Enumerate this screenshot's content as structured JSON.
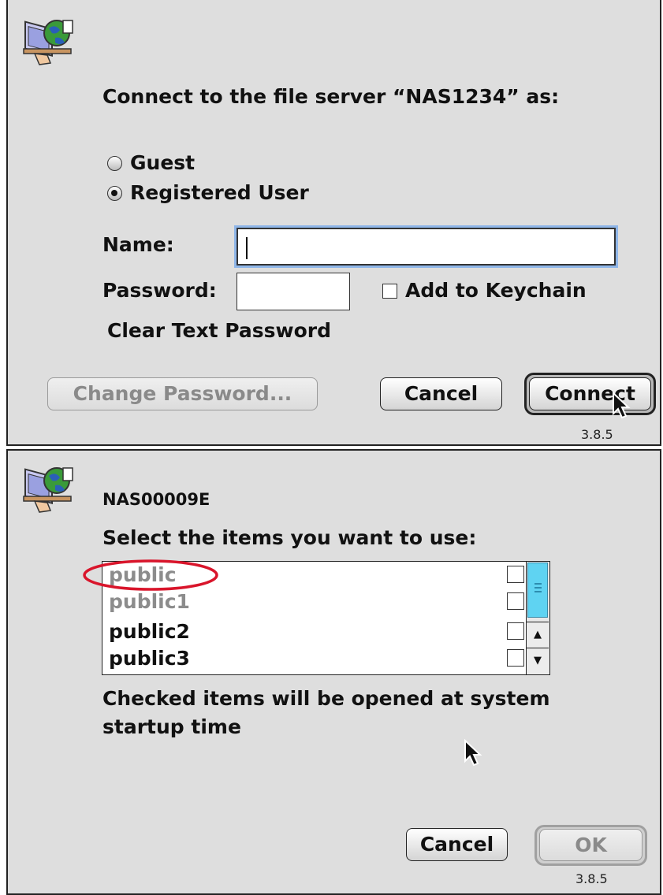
{
  "login_dialog": {
    "prompt": "Connect to the file server “NAS1234” as:",
    "guest_label": "Guest",
    "registered_label": "Registered User",
    "name_label": "Name:",
    "name_value": "",
    "password_label": "Password:",
    "add_keychain_label": "Add to Keychain",
    "clear_text_label": "Clear Text Password",
    "change_password_label": "Change Password...",
    "cancel_label": "Cancel",
    "connect_label": "Connect",
    "version": "3.8.5"
  },
  "volume_dialog": {
    "server_name": "NAS00009E",
    "prompt": "Select the items you want to use:",
    "items": [
      {
        "label": "public",
        "checked": false,
        "dim": true
      },
      {
        "label": "public1",
        "checked": false,
        "dim": true
      },
      {
        "label": "public2",
        "checked": false,
        "dim": false
      },
      {
        "label": "public3",
        "checked": false,
        "dim": false
      }
    ],
    "note_line1": "Checked items will be opened at system",
    "note_line2": "startup time",
    "cancel_label": "Cancel",
    "ok_label": "OK",
    "version": "3.8.5"
  },
  "icons": [
    "file-server-icon",
    "cursor-arrow-icon"
  ],
  "colors": {
    "panel_bg": "#dedede",
    "focus_ring": "#8fb6e8",
    "scroll_thumb": "#5fd3f2",
    "highlight_ellipse": "#d9152b"
  }
}
